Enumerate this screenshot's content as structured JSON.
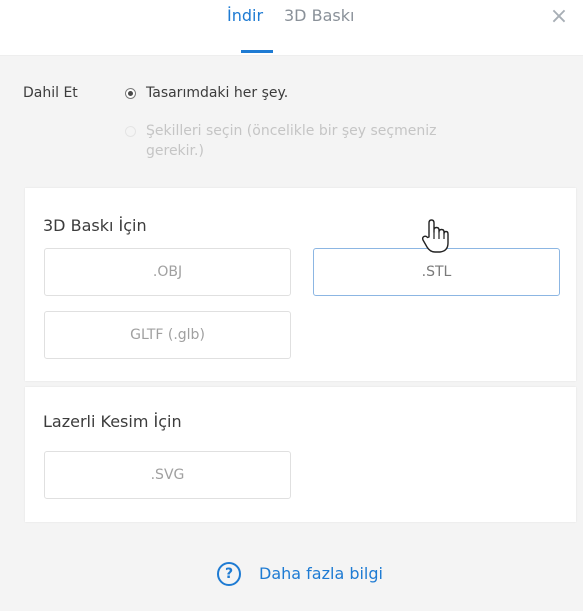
{
  "header": {
    "tabs": [
      {
        "label": "İndir",
        "active": true
      },
      {
        "label": "3D Baskı",
        "active": false
      }
    ],
    "close_icon": "close-icon",
    "close_glyph": "×"
  },
  "include": {
    "label": "Dahil Et",
    "options": [
      {
        "label": "Tasarımdaki her şey.",
        "selected": true,
        "enabled": true
      },
      {
        "label": "Şekilleri seçin (öncelikle bir şey seçmeniz gerekir.)",
        "selected": false,
        "enabled": false
      }
    ]
  },
  "print3d": {
    "title": "3D Baskı İçin",
    "buttons": [
      ".OBJ",
      ".STL",
      "GLTF (.glb)"
    ]
  },
  "laser": {
    "title": "Lazerli Kesim İçin",
    "buttons": [
      ".SVG"
    ]
  },
  "footer": {
    "help_icon": "help-circle-icon",
    "help_glyph": "?",
    "more_label": "Daha fazla bilgi"
  },
  "colors": {
    "accent": "#1e7bd3",
    "background": "#f4f4f4",
    "card": "#ffffff",
    "text": "#3c3c3c",
    "disabled_text": "#c5c5c5",
    "hover_border": "#8cb6e3"
  }
}
